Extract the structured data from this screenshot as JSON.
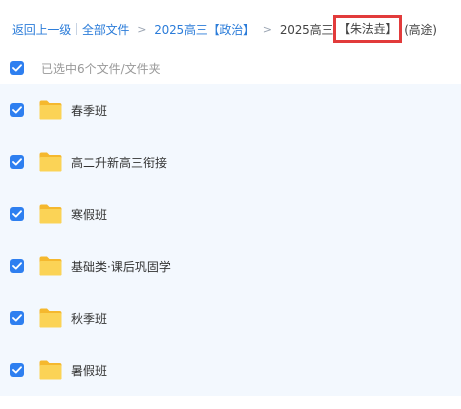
{
  "breadcrumb": {
    "back": "返回上一级",
    "all_files": "全部文件",
    "level1": "2025高三【政治】",
    "separator": ">",
    "current_prefix": "2025高三",
    "current_highlight": "【朱法垚】",
    "current_suffix": "(高途)"
  },
  "selection": {
    "label": "已选中6个文件/文件夹",
    "checked": true
  },
  "files": [
    {
      "name": "春季班",
      "type": "folder",
      "checked": true
    },
    {
      "name": "高二升新高三衔接",
      "type": "folder",
      "checked": true
    },
    {
      "name": "寒假班",
      "type": "folder",
      "checked": true
    },
    {
      "name": "基础类·课后巩固学",
      "type": "folder",
      "checked": true
    },
    {
      "name": "秋季班",
      "type": "folder",
      "checked": true
    },
    {
      "name": "暑假班",
      "type": "folder",
      "checked": true
    }
  ],
  "colors": {
    "link": "#2b7cd9",
    "checkbox": "#2e7ff0",
    "highlight_border": "#e23b3b",
    "folder": "#f7c948",
    "list_background": "#f3f8fe"
  },
  "icons": {
    "checkbox": "checkbox-checked-icon",
    "folder": "folder-icon"
  }
}
